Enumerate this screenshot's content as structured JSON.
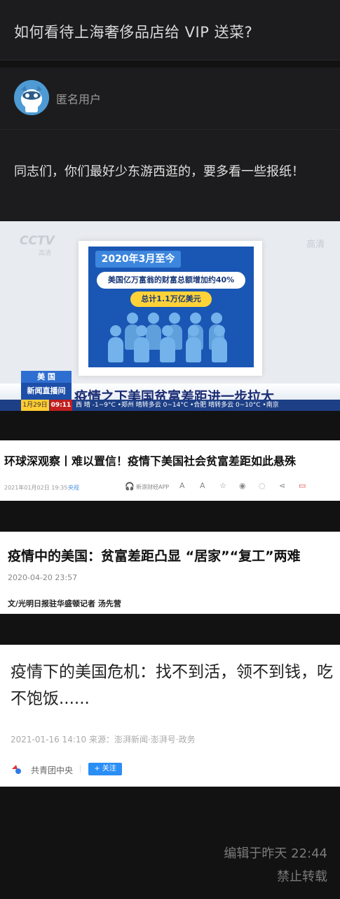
{
  "question": {
    "title": "如何看待上海奢侈品店给 VIP 送菜?"
  },
  "author": {
    "name": "匿名用户",
    "avatar_icon": "anonymous-avatar-icon"
  },
  "answer": {
    "text": "同志们，你们最好少东游西逛的，要多看一些报纸！",
    "edit_time": "编辑于昨天 22:44",
    "repost_notice": "禁止转载"
  },
  "images": {
    "tv": {
      "logo": "CCTV",
      "logo_sub": "高清",
      "corner_mark": "高清",
      "board_date": "2020年3月至今",
      "board_line1": "美国亿万富翁的财富总额增加约40%",
      "board_line2": "总计1.1万亿美元",
      "channel_top": "美 国",
      "channel_bottom": "新闻直播间",
      "headline": "疫情之下美国贫富差距进一步拉大",
      "ticker_date": "1月29日",
      "ticker_time": "09:11",
      "ticker_text": "西 晴 -1~9°C  •郑州 晴转多云 0~14°C  •合肥 晴转多云 0~10°C  •南京"
    },
    "article1": {
      "title": "环球深观察丨难以置信！疫情下美国社会贫富差距如此悬殊",
      "date": "2021年01月02日 19:35",
      "source": "央视",
      "app_label": "新浪财经APP"
    },
    "article2": {
      "title": "疫情中的美国：贫富差距凸显 “居家”“复工”两难",
      "time": "2020-04-20 23:57",
      "author": "文/光明日报驻华盛顿记者 汤先营"
    },
    "article3": {
      "title": "疫情下的美国危机：找不到活，领不到钱，吃不饱饭......",
      "meta": "2021-01-16 14:10 来源：澎湃新闻·澎湃号·政务",
      "account": "共青团中央",
      "follow": "+ 关注"
    }
  }
}
